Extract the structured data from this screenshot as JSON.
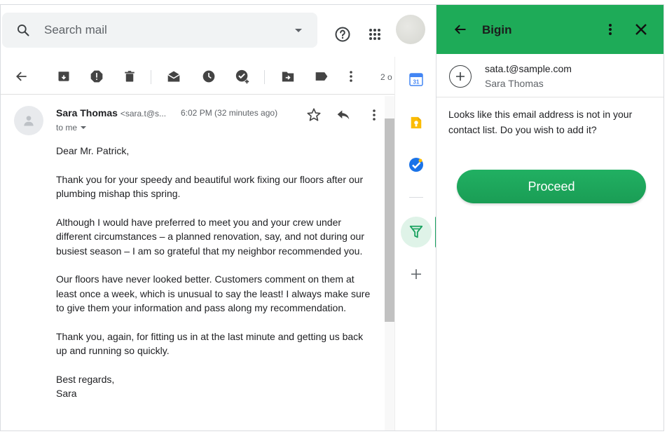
{
  "search": {
    "placeholder": "Search mail"
  },
  "toolbar": {
    "count": "2 o"
  },
  "message": {
    "sender_name": "Sara Thomas",
    "sender_email": "<sara.t@s...",
    "time": "6:02 PM (32 minutes ago)",
    "to": "to me",
    "greeting": "Dear Mr. Patrick,",
    "paragraphs": [
      "Thank you for your speedy and beautiful work fixing our floors after our plumbing mishap this spring.",
      "Although I would have preferred to meet you and your crew under different circumstances – a planned renovation, say, and not during our busiest season – I am so grateful that my neighbor recommended you.",
      "Our floors have never looked better. Customers comment on them at least once a week, which is unusual to say the least! I always make sure to give them your information and pass along my recommendation.",
      "Thank you, again, for fitting us in at the last minute and getting us back up and running so quickly."
    ],
    "closing": "Best regards,",
    "signature": "Sara"
  },
  "side_strip": {
    "calendar_label": "31"
  },
  "panel": {
    "title": "Bigin",
    "contact_email": "sata.t@sample.com",
    "contact_name": "Sara Thomas",
    "notice": "Looks like this email address is not in your contact list. Do you wish to add it?",
    "proceed_label": "Proceed"
  },
  "colors": {
    "bigin_green": "#1eab58",
    "button_green": "#1fa85c"
  }
}
